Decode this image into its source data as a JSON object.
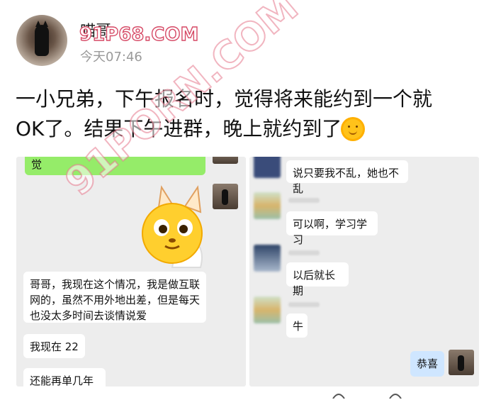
{
  "post": {
    "username": "喵哥",
    "timestamp": "今天07:46",
    "watermark_top": "91P68.COM",
    "watermark_diag": "91PORN.COM",
    "text_line1": "一小兄弟，下午报名时，觉得将来能约到一个就",
    "text_line2": "OK了。结果下午进群，晚上就约到了",
    "emoji_icon": "sun-smile-icon"
  },
  "chat_left": {
    "top_partial": "觉",
    "messages": [
      "哥哥，我现在这个情况，我是做互联网的，虽然不用外地出差，但是每天也没太多时间去谈情说爱",
      "我现在 22",
      "还能再单几年"
    ]
  },
  "chat_right": {
    "messages": [
      "说只要我不乱，她也不乱",
      "可以啊，学习学习",
      "以后就长期",
      "牛",
      "恭喜"
    ]
  },
  "colors": {
    "panel_bg": "#ededed",
    "bubble_green": "#95ec69",
    "bubble_blue": "#cfe6ff"
  }
}
